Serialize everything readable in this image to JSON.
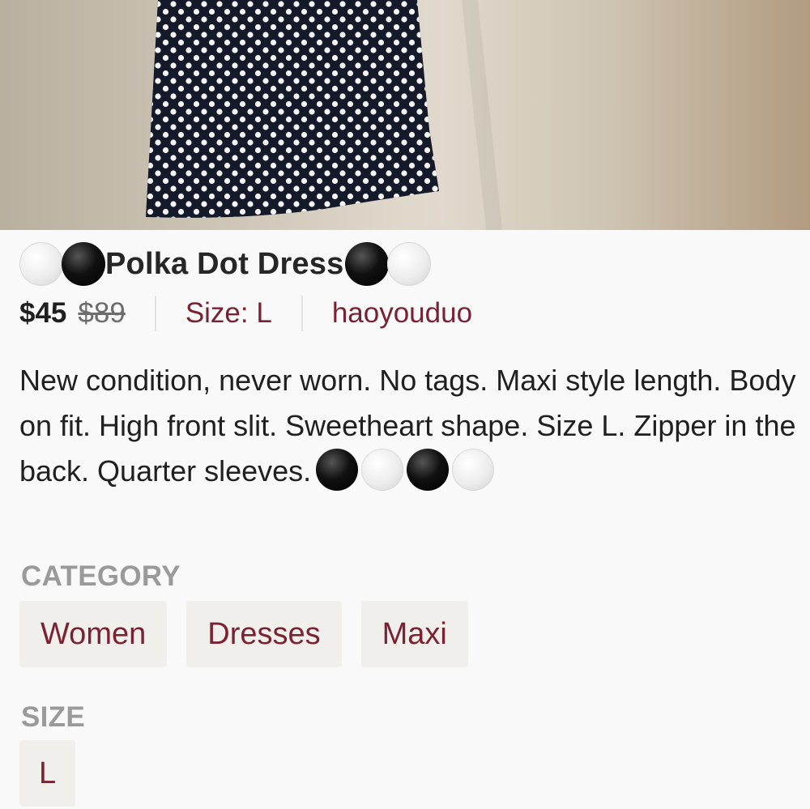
{
  "listing": {
    "title": "Polka Dot Dress",
    "price": "$45",
    "original_price": "$89",
    "size_label": "Size: L",
    "seller": "haoyouduo",
    "description": "New condition, never worn. No tags. Maxi style length. Body on fit. High front slit. Sweetheart shape. Size L. Zipper in the back. Quarter sleeves."
  },
  "category": {
    "label": "CATEGORY",
    "chips": [
      "Women",
      "Dresses",
      "Maxi"
    ]
  },
  "size": {
    "label": "SIZE",
    "chips": [
      "L"
    ]
  },
  "colors": {
    "accent": "#7b2232",
    "section_label": "#9a9a9a",
    "chip_background": "#f1efeb"
  },
  "icons": [
    "white-circle-emoji-icon",
    "black-circle-emoji-icon"
  ]
}
